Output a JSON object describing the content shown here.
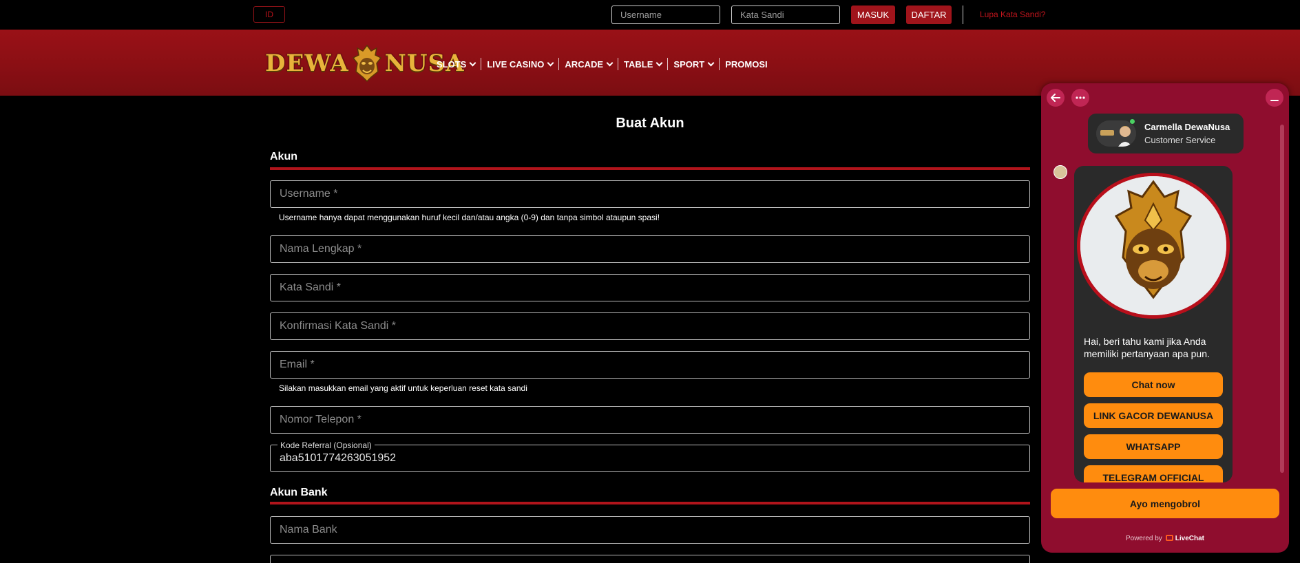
{
  "topbar": {
    "lang": "ID",
    "username_placeholder": "Username",
    "password_placeholder": "Kata Sandi",
    "login_label": "MASUK",
    "register_label": "DAFTAR",
    "forgot_label": "Lupa Kata Sandi?"
  },
  "brand": {
    "left": "DEWA",
    "right": "NUSA",
    "gold": "#e8b33b",
    "red": "#9a1117"
  },
  "nav": {
    "items": [
      {
        "label": "SLOTS"
      },
      {
        "label": "LIVE CASINO"
      },
      {
        "label": "ARCADE"
      },
      {
        "label": "TABLE"
      },
      {
        "label": "SPORT"
      },
      {
        "label": "PROMOSI"
      }
    ]
  },
  "form": {
    "title": "Buat Akun",
    "account_section": "Akun",
    "username_placeholder": "Username *",
    "username_hint": "Username hanya dapat menggunakan huruf kecil dan/atau angka (0-9) dan tanpa simbol ataupun spasi!",
    "fullname_placeholder": "Nama Lengkap *",
    "password_placeholder": "Kata Sandi *",
    "confirm_placeholder": "Konfirmasi Kata Sandi *",
    "email_placeholder": "Email *",
    "email_hint": "Silakan masukkan email yang aktif untuk keperluan reset kata sandi",
    "phone_placeholder": "Nomor Telepon *",
    "referral_label": "Kode Referral (Opsional)",
    "referral_value": "aba5101774263051952",
    "bank_section": "Akun Bank",
    "bank_placeholder": "Nama Bank"
  },
  "chat": {
    "agent_name": "Carmella DewaNusa",
    "agent_role": "Customer Service",
    "message": "Hai, beri tahu kami jika Anda memiliki pertanyaan apa pun.",
    "buttons": [
      {
        "label": "Chat now"
      },
      {
        "label": "LINK GACOR DEWANUSA"
      },
      {
        "label": "WHATSAPP"
      },
      {
        "label": "TELEGRAM OFFICIAL"
      }
    ],
    "cta_label": "Ayo mengobrol",
    "powered_by": "Powered by",
    "powered_brand": "LiveChat",
    "accent": "#ff8c0e",
    "background": "#8f0d2e"
  }
}
